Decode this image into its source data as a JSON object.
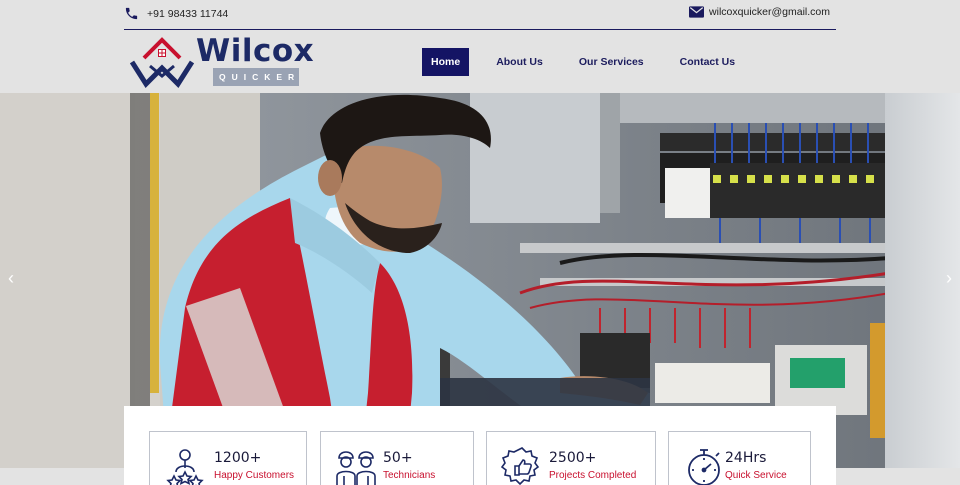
{
  "contact": {
    "phone": "+91 98433 11744",
    "email": "wilcoxquicker@gmail.com",
    "phone_icon": "phone-icon",
    "email_icon": "envelope-icon"
  },
  "brand": {
    "name": "Wilcox",
    "tagline": "QUICKER",
    "primary_color": "#1d2a66",
    "accent_color": "#c8102e"
  },
  "nav": {
    "items": [
      {
        "label": "Home",
        "active": true
      },
      {
        "label": "About Us",
        "active": false
      },
      {
        "label": "Our Services",
        "active": false
      },
      {
        "label": "Contact Us",
        "active": false
      }
    ]
  },
  "carousel": {
    "prev_icon": "chevron-left-icon",
    "next_icon": "chevron-right-icon",
    "prev_glyph": "‹",
    "next_glyph": "›"
  },
  "stats": [
    {
      "value": "1200+",
      "label": "Happy Customers",
      "icon": "happy-customers-icon"
    },
    {
      "value": "50+",
      "label": "Technicians",
      "icon": "technicians-icon"
    },
    {
      "value": "2500+",
      "label": "Projects Completed",
      "icon": "projects-badge-icon"
    },
    {
      "value": "24Hrs",
      "label": "Quick Service",
      "icon": "stopwatch-icon"
    }
  ]
}
